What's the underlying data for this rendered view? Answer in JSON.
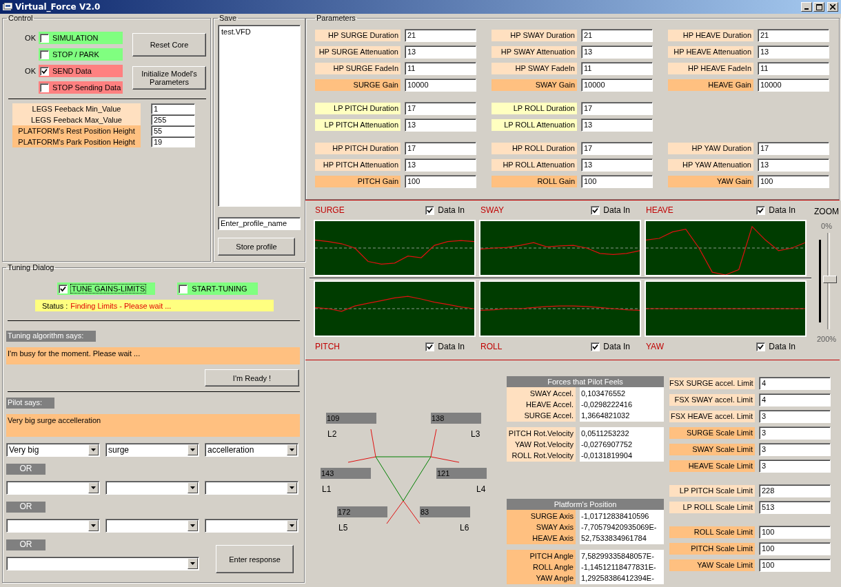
{
  "window": {
    "title": "Virtual_Force V2.0"
  },
  "control": {
    "title": "Control",
    "options": [
      {
        "status": "OK",
        "label": "SIMULATION",
        "checked": false,
        "color": "#80ff80"
      },
      {
        "label": "STOP / PARK",
        "checked": false,
        "color": "#80ff80"
      },
      {
        "status": "OK",
        "label": "SEND Data",
        "checked": true,
        "color": "#ff8080"
      },
      {
        "label": "STOP Sending Data",
        "checked": false,
        "color": "#ff8080"
      }
    ],
    "buttons": [
      "Reset Core",
      "Initialize Model's Parameters"
    ],
    "legs_settings": [
      {
        "label": "LEGS Feeback Min_Value",
        "value": "1",
        "color": "#ffe0c0"
      },
      {
        "label": "LEGS Feeback Max_Value",
        "value": "255",
        "color": "#ffe0c0"
      },
      {
        "label": "PLATFORM's Rest Position Height",
        "value": "55",
        "color": "#ffc080"
      },
      {
        "label": "PLATFORM's Park Position Height",
        "value": "19",
        "color": "#ffc080"
      }
    ]
  },
  "save": {
    "title": "Save",
    "files": [
      {
        "name": "test.VFD",
        "selected": false
      }
    ],
    "profile_name": "Enter_profile_name",
    "button": "Store profile"
  },
  "tuning": {
    "title": "Tuning Dialog",
    "options": [
      {
        "label": "TUNE GAINS-LIMITS",
        "checked": true,
        "focused": true,
        "color": "#80ff80"
      },
      {
        "label": "START-TUNING",
        "checked": false,
        "focused": false,
        "color": "#80ff80"
      }
    ],
    "status_label": "Status :",
    "status_text": "Finding Limits - Please wait ...",
    "algorithm_title": "Tuning algorithm says:",
    "algorithm_message": "I'm busy for the moment. Please wait ...",
    "ready_button": "I'm Ready !",
    "pilot_title": "Pilot says:",
    "pilot_message": "Very big surge accelleration",
    "choice_rows": [
      {
        "dropdowns": [
          {
            "kind": "normal",
            "value": "Very big"
          },
          {
            "kind": "normal",
            "value": "surge"
          },
          {
            "kind": "normal",
            "value": "accelleration"
          }
        ]
      },
      {
        "separator": "OR",
        "dropdowns": [
          {
            "kind": "normal"
          },
          {
            "kind": "normal"
          },
          {
            "kind": "normal"
          }
        ]
      },
      {
        "separator": "OR",
        "dropdowns": [
          {
            "kind": "normal"
          },
          {
            "kind": "normal"
          },
          {
            "kind": "normal"
          }
        ]
      },
      {
        "separator": "OR",
        "dropdowns": [
          {
            "kind": "wide"
          }
        ]
      }
    ],
    "enter_button": "Enter response"
  },
  "parameters": {
    "title": "Parameters",
    "groups": [
      {
        "columns": [
          [
            {
              "label": "HP SURGE Duration",
              "value": "21",
              "color": "#ffe0c0"
            },
            {
              "label": "HP SURGE Attenuation",
              "value": "13",
              "color": "#ffe0c0"
            },
            {
              "label": "HP SURGE FadeIn",
              "value": "11",
              "color": "#ffe0c0"
            },
            {
              "label": "SURGE Gain",
              "value": "10000",
              "color": "#ffc080"
            }
          ],
          [
            {
              "label": "HP SWAY Duration",
              "value": "21",
              "color": "#ffe0c0"
            },
            {
              "label": "HP SWAY Attenuation",
              "value": "13",
              "color": "#ffe0c0"
            },
            {
              "label": "HP SWAY FadeIn",
              "value": "11",
              "color": "#ffe0c0"
            },
            {
              "label": "SWAY Gain",
              "value": "10000",
              "color": "#ffc080"
            }
          ],
          [
            {
              "label": "HP HEAVE Duration",
              "value": "21",
              "color": "#ffe0c0"
            },
            {
              "label": "HP HEAVE Attenuation",
              "value": "13",
              "color": "#ffe0c0"
            },
            {
              "label": "HP HEAVE FadeIn",
              "value": "11",
              "color": "#ffe0c0"
            },
            {
              "label": "HEAVE Gain",
              "value": "10000",
              "color": "#ffc080"
            }
          ]
        ]
      },
      {
        "columns": [
          [
            {
              "label": "LP PITCH Duration",
              "value": "17",
              "color": "#ffffc0"
            },
            {
              "label": "LP PITCH Attenuation",
              "value": "13",
              "color": "#ffffc0"
            }
          ],
          [
            {
              "label": "LP ROLL Duration",
              "value": "17",
              "color": "#ffffc0"
            },
            {
              "label": "LP ROLL Attenuation",
              "value": "13",
              "color": "#ffffc0"
            }
          ]
        ]
      },
      {
        "columns": [
          [
            {
              "label": "HP PITCH Duration",
              "value": "17",
              "color": "#ffe0c0"
            },
            {
              "label": "HP PITCH Attenuation",
              "value": "13",
              "color": "#ffe0c0"
            },
            {
              "label": "PITCH Gain",
              "value": "100",
              "color": "#ffc080"
            }
          ],
          [
            {
              "label": "HP ROLL Duration",
              "value": "17",
              "color": "#ffe0c0"
            },
            {
              "label": "HP ROLL Attenuation",
              "value": "13",
              "color": "#ffe0c0"
            },
            {
              "label": "ROLL Gain",
              "value": "100",
              "color": "#ffc080"
            }
          ],
          [
            {
              "label": "HP YAW Duration",
              "value": "17",
              "color": "#ffe0c0"
            },
            {
              "label": "HP YAW Attenuation",
              "value": "13",
              "color": "#ffe0c0"
            },
            {
              "label": "YAW Gain",
              "value": "100",
              "color": "#ffc080"
            }
          ]
        ]
      }
    ]
  },
  "graphs": [
    {
      "title": "SURGE",
      "data_in_label": "Data In",
      "data_in": true
    },
    {
      "title": "SWAY",
      "data_in_label": "Data In",
      "data_in": true
    },
    {
      "title": "HEAVE",
      "data_in_label": "Data In",
      "data_in": true
    },
    {
      "title": "PITCH",
      "data_in_label": "Data In",
      "data_in": true
    },
    {
      "title": "ROLL",
      "data_in_label": "Data In",
      "data_in": true
    },
    {
      "title": "YAW",
      "data_in_label": "Data In",
      "data_in": true
    }
  ],
  "zoom": {
    "title": "ZOOM",
    "min_label": "0%",
    "max_label": "200%",
    "level": 0.5
  },
  "legs": [
    {
      "value": "109",
      "label": "L2"
    },
    {
      "value": "138",
      "label": "L3"
    },
    {
      "value": "143",
      "label": "L1"
    },
    {
      "value": "121",
      "label": "L4"
    },
    {
      "value": "172",
      "label": "L5"
    },
    {
      "value": "83",
      "label": "L6"
    }
  ],
  "forces": {
    "title": "Forces that Pilot Feels",
    "color": "#ffe0c0",
    "groups": [
      [
        {
          "label": "SWAY Accel.",
          "value": "0,103476552"
        },
        {
          "label": "HEAVE Accel.",
          "value": "-0,0298222416"
        },
        {
          "label": "SURGE Accel.",
          "value": "1,3664821032"
        }
      ],
      [
        {
          "label": "PITCH Rot.Velocity",
          "value": "0,0511253232"
        },
        {
          "label": "YAW Rot.Velocity",
          "value": "-0,0276907752"
        },
        {
          "label": "ROLL Rot.Velocity",
          "value": "-0,0131819904"
        }
      ]
    ]
  },
  "position": {
    "title": "Platform's Position",
    "color": "#ffc080",
    "groups": [
      [
        {
          "label": "SURGE Axis",
          "value": "-1,01712838410596"
        },
        {
          "label": "SWAY Axis",
          "value": "-7,70579420935069E-"
        },
        {
          "label": "HEAVE Axis",
          "value": "52,7533834961784"
        }
      ],
      [
        {
          "label": "PITCH Angle",
          "value": "7,58299335848057E-"
        },
        {
          "label": "ROLL Angle",
          "value": "-1,14512118477831E-"
        },
        {
          "label": "YAW Angle",
          "value": "1,29258386412394E-"
        }
      ]
    ]
  },
  "limits": [
    [
      {
        "label": "FSX SURGE accel. Limit",
        "value": "4",
        "color": "#ffe0c0"
      },
      {
        "label": "FSX SWAY accel. Limit",
        "value": "4",
        "color": "#ffe0c0"
      },
      {
        "label": "FSX HEAVE accel. Limit",
        "value": "3",
        "color": "#ffe0c0"
      },
      {
        "label": "SURGE Scale Limit",
        "value": "3",
        "color": "#ffc080"
      },
      {
        "label": "SWAY Scale  Limit",
        "value": "3",
        "color": "#ffc080"
      },
      {
        "label": "HEAVE Scale Limit",
        "value": "3",
        "color": "#ffc080"
      }
    ],
    [
      {
        "label": "LP PITCH Scale Limit",
        "value": "228",
        "color": "#ffe0c0"
      },
      {
        "label": "LP ROLL Scale Limit",
        "value": "513",
        "color": "#ffe0c0"
      }
    ],
    [
      {
        "label": "ROLL Scale Limit",
        "value": "100",
        "color": "#ffc080"
      },
      {
        "label": "PITCH Scale Limit",
        "value": "100",
        "color": "#ffc080"
      },
      {
        "label": "YAW Scale Limit",
        "value": "100",
        "color": "#ffc080"
      }
    ]
  ]
}
